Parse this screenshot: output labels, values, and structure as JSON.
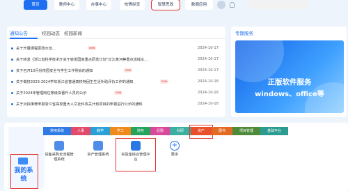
{
  "nav": {
    "tabs": [
      {
        "label": "首页",
        "active": true
      },
      {
        "label": "教师中心"
      },
      {
        "label": "办事中心"
      },
      {
        "label": "校情纵览"
      },
      {
        "label": "智慧思政",
        "highlight": true
      },
      {
        "label": "数据应用"
      }
    ]
  },
  "notice": {
    "tabs": [
      "通知公告",
      "校园动态",
      "校园新闻"
    ],
    "items": [
      {
        "title": "关于开展课程思政示范...",
        "date": "2024-10-17",
        "new": true
      },
      {
        "title": "关于转发《浙江省科学技术厅关于转发国家重点研发计划“长江黄河等重点流域水...",
        "date": "2024-10-17"
      },
      {
        "title": "关于召开10月份校园安全与学生工作例会的通知",
        "date": "2024-10-17",
        "new": true
      },
      {
        "title": "关于做好2023-2024学年浙江省普通高校特困生生活补助评价工作的通知",
        "date": "2024-10-16",
        "new": true
      },
      {
        "title": "关于2024年管理岗位等级拟晋升人员的公示",
        "date": "2024-10-16",
        "new": true
      },
      {
        "title": "关于对拟推荐申报浙江省高校重大人文社科攻关计划项目的申报进行公示的通知",
        "date": "2024-10-16"
      }
    ],
    "new_label": "new"
  },
  "special": {
    "title": "专题服务",
    "banner_line1": "正版软件服务",
    "banner_line2": "windows、office等"
  },
  "mysys": {
    "title": "我的系统",
    "categories": [
      {
        "label": "常用系统",
        "color": "#2f7ae5"
      },
      {
        "label": "人事",
        "color": "#e14a6a"
      },
      {
        "label": "教学",
        "color": "#2aa0d8"
      },
      {
        "label": "学工",
        "color": "#f08a1c"
      },
      {
        "label": "财务",
        "color": "#23a35b"
      },
      {
        "label": "后勤",
        "color": "#d9489a"
      },
      {
        "label": "科研",
        "color": "#3bb0a0"
      },
      {
        "label": "资产",
        "color": "#e94f2a",
        "highlight": true
      },
      {
        "label": "图书",
        "color": "#e26a22"
      },
      {
        "label": "项目管理",
        "color": "#4e8a38"
      },
      {
        "label": "基础平台",
        "color": "#2b9c8f"
      }
    ],
    "systems": [
      {
        "label": "设备采购全流程管理系统",
        "color": "#4f8de8"
      },
      {
        "label": "资产管理系统",
        "color": "#4f8de8"
      },
      {
        "label": "实验室综合管理平台",
        "color": "#2a78e4",
        "highlight": true
      },
      {
        "label": "更多",
        "color": "#1e6ff0"
      }
    ]
  }
}
